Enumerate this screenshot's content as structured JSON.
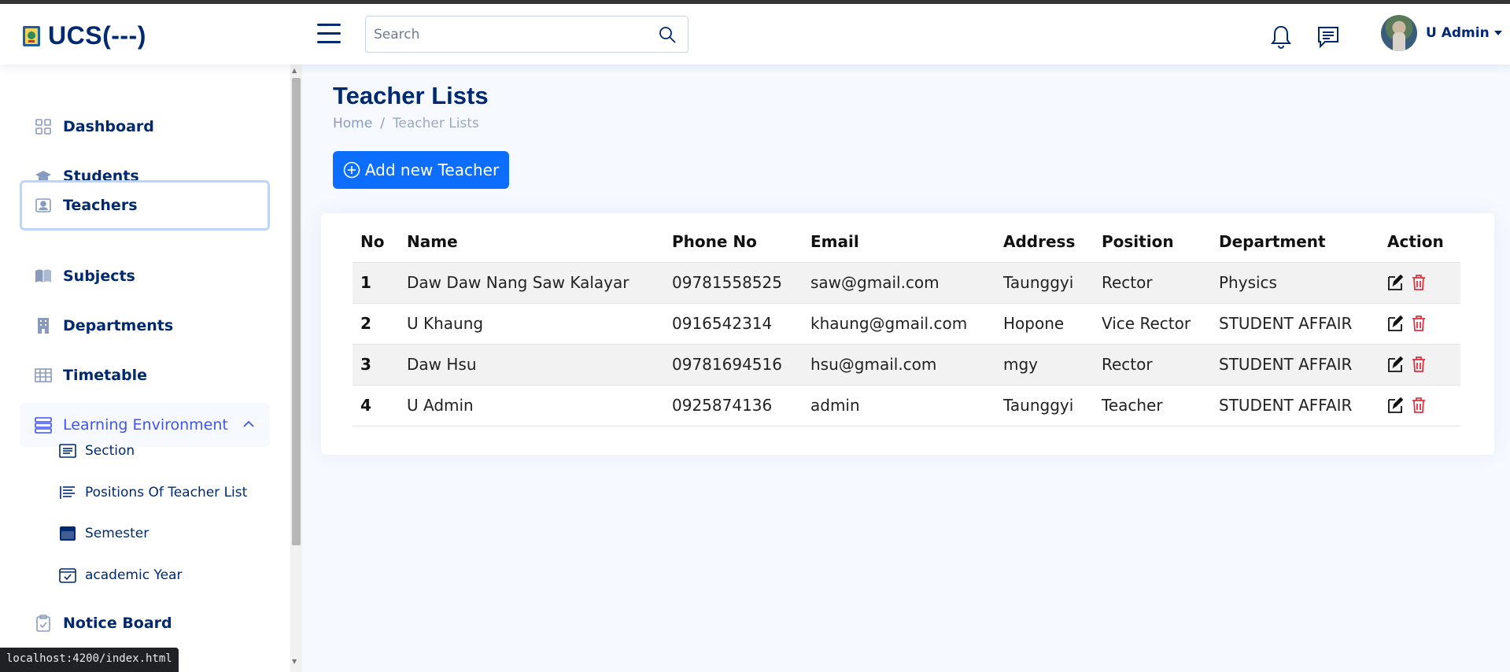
{
  "brand": {
    "title": "UCS(---)"
  },
  "search": {
    "placeholder": "Search"
  },
  "user": {
    "name": "U Admin"
  },
  "sidebar": {
    "items": [
      {
        "label": "Dashboard",
        "icon": "grid-icon"
      },
      {
        "label": "Students",
        "icon": "graduation-cap-icon"
      },
      {
        "label": "Teachers",
        "icon": "person-badge-icon",
        "active": true
      },
      {
        "label": "Subjects",
        "icon": "book-icon"
      },
      {
        "label": "Departments",
        "icon": "building-icon"
      },
      {
        "label": "Timetable",
        "icon": "table-icon"
      },
      {
        "label": "Learning Environment",
        "icon": "server-icon",
        "expanded": true
      },
      {
        "label": "Notice Board",
        "icon": "clipboard-icon"
      }
    ],
    "subitems": [
      {
        "label": "Section",
        "icon": "list-card-icon"
      },
      {
        "label": "Positions Of Teacher List",
        "icon": "text-list-icon"
      },
      {
        "label": "Semester",
        "icon": "calendar-month-icon"
      },
      {
        "label": "academic Year",
        "icon": "calendar-check-icon"
      }
    ]
  },
  "page": {
    "title": "Teacher Lists",
    "breadcrumb": {
      "home": "Home",
      "separator": "/",
      "current": "Teacher Lists"
    },
    "add_button": "Add new Teacher"
  },
  "table": {
    "headers": [
      "No",
      "Name",
      "Phone No",
      "Email",
      "Address",
      "Position",
      "Department",
      "Action"
    ],
    "rows": [
      [
        "1",
        "Daw Daw Nang Saw Kalayar",
        "09781558525",
        "saw@gmail.com",
        "Taunggyi",
        "Rector",
        "Physics"
      ],
      [
        "2",
        "U Khaung",
        "0916542314",
        "khaung@gmail.com",
        "Hopone",
        "Vice Rector",
        "STUDENT AFFAIR"
      ],
      [
        "3",
        "Daw Hsu",
        "09781694516",
        "hsu@gmail.com",
        "mgy",
        "Rector",
        "STUDENT AFFAIR"
      ],
      [
        "4",
        "U Admin",
        "0925874136",
        "admin",
        "Taunggyi",
        "Teacher",
        "STUDENT AFFAIR"
      ]
    ]
  },
  "status_bar": {
    "url": "localhost:4200/index.html"
  },
  "colors": {
    "primary": "#0d6efd",
    "nav_text": "#012970",
    "delete": "#dc3545",
    "active_border": "#bcd6fb"
  }
}
